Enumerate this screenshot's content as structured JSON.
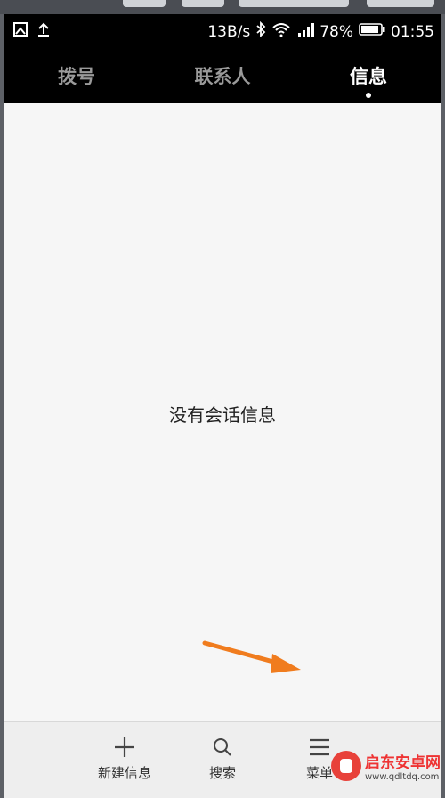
{
  "status_bar": {
    "speed": "13B/s",
    "battery": "78%",
    "time": "01:55"
  },
  "tabs": [
    {
      "label": "拨号",
      "active": false
    },
    {
      "label": "联系人",
      "active": false
    },
    {
      "label": "信息",
      "active": true
    }
  ],
  "content": {
    "empty_message": "没有会话信息"
  },
  "bottom_bar": {
    "new_message": "新建信息",
    "search": "搜索",
    "menu": "菜单"
  },
  "watermark": {
    "title": "启东安卓网",
    "url": "www.qdltdq.com"
  },
  "colors": {
    "annotation_arrow": "#f07c1e",
    "watermark_red": "#e33333"
  }
}
